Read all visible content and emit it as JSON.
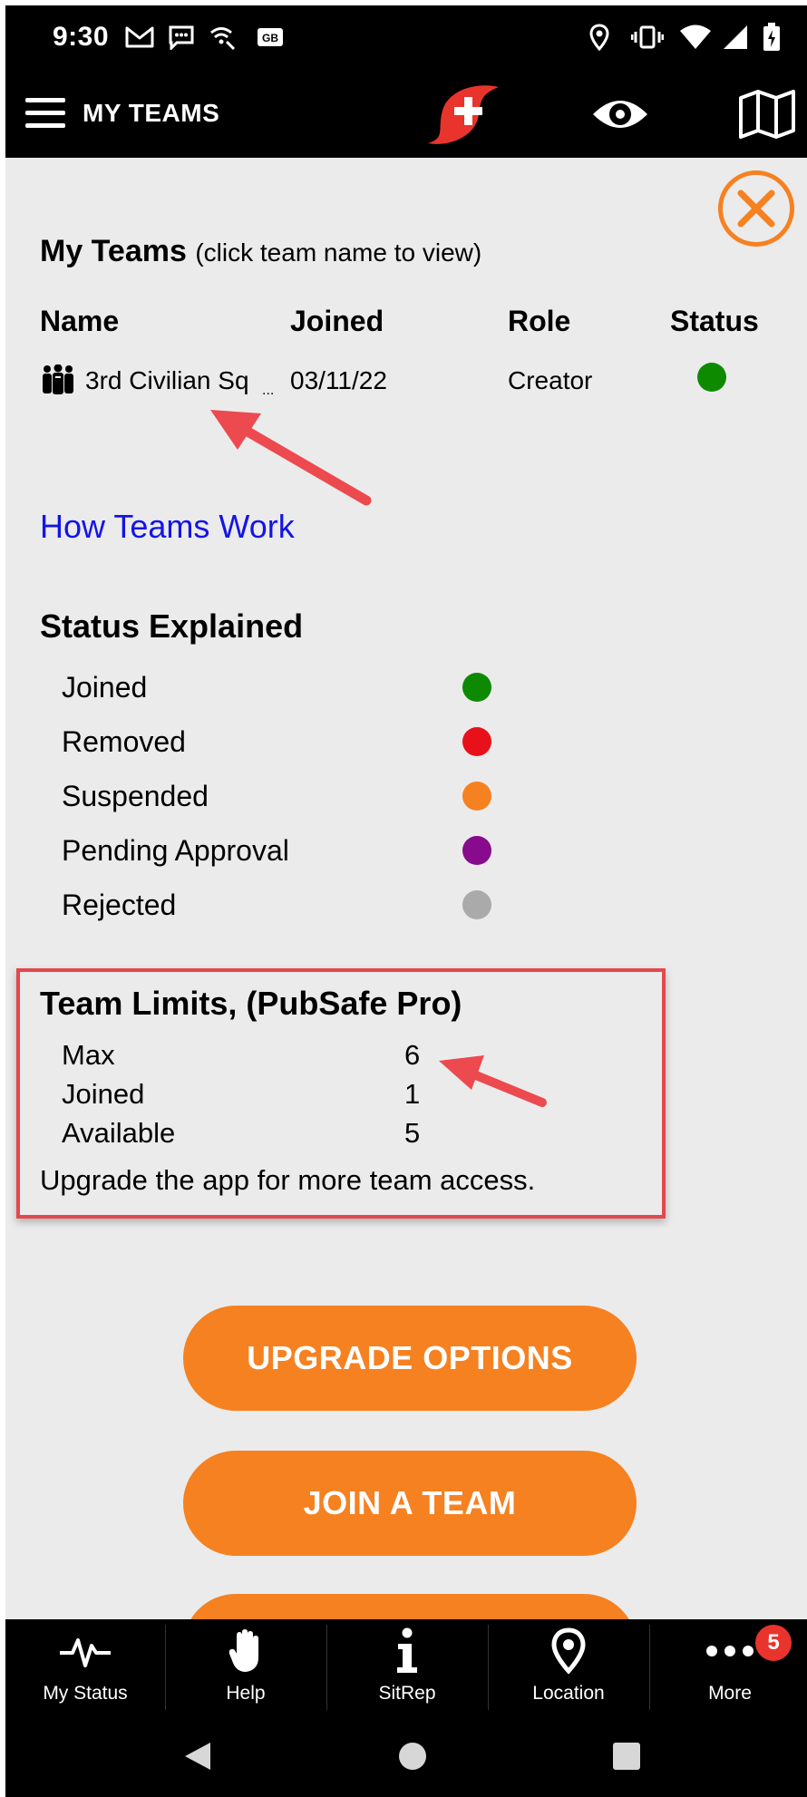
{
  "status_bar": {
    "time": "9:30",
    "icons": [
      "gmail-icon",
      "message-icon",
      "wifi-calling-icon",
      "sim-icon",
      "location-pin-icon",
      "vibrate-icon",
      "wifi-icon",
      "cell-signal-icon",
      "battery-charging-icon"
    ]
  },
  "app_bar": {
    "title": "MY TEAMS",
    "icons": [
      "menu-icon",
      "logo-icon",
      "eye-icon",
      "map-icon"
    ]
  },
  "my_teams": {
    "title": "My Teams",
    "subtitle": "(click team name to view)",
    "columns": [
      "Name",
      "Joined",
      "Role",
      "Status"
    ],
    "rows": [
      {
        "name": "3rd Civilian Sq",
        "ellipsis": "...",
        "joined": "03/11/22",
        "role": "Creator",
        "status_color": "#0d8a00"
      }
    ]
  },
  "how_teams_link": "How Teams Work",
  "status_explained": {
    "title": "Status Explained",
    "items": [
      {
        "label": "Joined",
        "color": "#0d8a00"
      },
      {
        "label": "Removed",
        "color": "#e8111a"
      },
      {
        "label": "Suspended",
        "color": "#f68121"
      },
      {
        "label": "Pending Approval",
        "color": "#870b8c"
      },
      {
        "label": "Rejected",
        "color": "#aaaaaa"
      }
    ]
  },
  "team_limits": {
    "title": "Team Limits, (PubSafe Pro)",
    "rows": [
      {
        "label": "Max",
        "value": "6"
      },
      {
        "label": "Joined",
        "value": "1"
      },
      {
        "label": "Available",
        "value": "5"
      }
    ],
    "note": "Upgrade the app for more team access."
  },
  "buttons": {
    "upgrade": "UPGRADE OPTIONS",
    "join": "JOIN A TEAM"
  },
  "bottom_nav": {
    "items": [
      {
        "label": "My Status",
        "icon": "heartbeat-icon"
      },
      {
        "label": "Help",
        "icon": "hand-icon"
      },
      {
        "label": "SitRep",
        "icon": "info-icon"
      },
      {
        "label": "Location",
        "icon": "location-pin-icon"
      },
      {
        "label": "More",
        "icon": "more-dots-icon",
        "badge": "5"
      }
    ]
  },
  "system_nav": [
    "back-icon",
    "home-icon",
    "recents-icon"
  ],
  "colors": {
    "accent": "#f68121",
    "link": "#1414e6",
    "highlight_border": "#e4484c",
    "arrow": "#ec4a4f"
  }
}
